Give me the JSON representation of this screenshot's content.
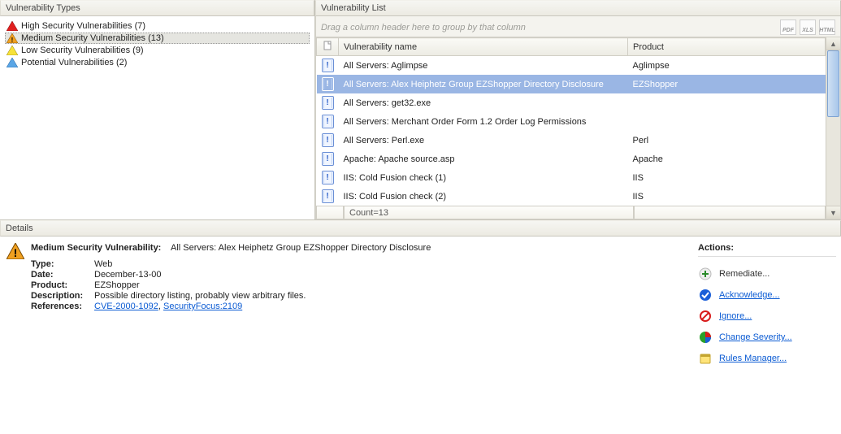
{
  "left_panel": {
    "title": "Vulnerability Types",
    "items": [
      {
        "label": "High Security Vulnerabilities (7)",
        "severity": "high",
        "selected": false
      },
      {
        "label": "Medium Security Vulnerabilities (13)",
        "severity": "medium",
        "selected": true
      },
      {
        "label": "Low Security Vulnerabilities (9)",
        "severity": "low",
        "selected": false
      },
      {
        "label": "Potential Vulnerabilities (2)",
        "severity": "potential",
        "selected": false
      }
    ]
  },
  "right_panel": {
    "title": "Vulnerability List",
    "group_hint": "Drag a column header here to group by that column",
    "export": {
      "pdf": "PDF",
      "xls": "XLS",
      "html": "HTML"
    },
    "columns": {
      "icon": "",
      "name": "Vulnerability name",
      "product": "Product"
    },
    "rows": [
      {
        "name": "All Servers: Aglimpse",
        "product": "Aglimpse",
        "selected": false
      },
      {
        "name": "All Servers: Alex Heiphetz Group EZShopper Directory Disclosure",
        "product": "EZShopper",
        "selected": true
      },
      {
        "name": "All Servers: get32.exe",
        "product": "",
        "selected": false
      },
      {
        "name": "All Servers: Merchant Order Form 1.2 Order Log Permissions",
        "product": "",
        "selected": false
      },
      {
        "name": "All Servers: Perl.exe",
        "product": "Perl",
        "selected": false
      },
      {
        "name": "Apache: Apache source.asp",
        "product": "Apache",
        "selected": false
      },
      {
        "name": "IIS: Cold Fusion check (1)",
        "product": "IIS",
        "selected": false
      },
      {
        "name": "IIS: Cold Fusion check (2)",
        "product": "IIS",
        "selected": false
      }
    ],
    "footer_count": "Count=13"
  },
  "details": {
    "title": "Details",
    "heading_label": "Medium Security Vulnerability:",
    "heading_value": "All Servers: Alex Heiphetz Group EZShopper Directory Disclosure",
    "fields": {
      "type_label": "Type:",
      "type_value": "Web",
      "date_label": "Date:",
      "date_value": "December-13-00",
      "product_label": "Product:",
      "product_value": "EZShopper",
      "description_label": "Description:",
      "description_value": "Possible directory listing, probably view arbitrary files.",
      "references_label": "References:"
    },
    "references": [
      {
        "text": "CVE-2000-1092"
      },
      {
        "text": "SecurityFocus:2109"
      }
    ],
    "actions_title": "Actions:",
    "actions": {
      "remediate": "Remediate...",
      "acknowledge": "Acknowledge...",
      "ignore": "Ignore...",
      "change_severity": "Change Severity...",
      "rules_manager": "Rules Manager..."
    }
  }
}
